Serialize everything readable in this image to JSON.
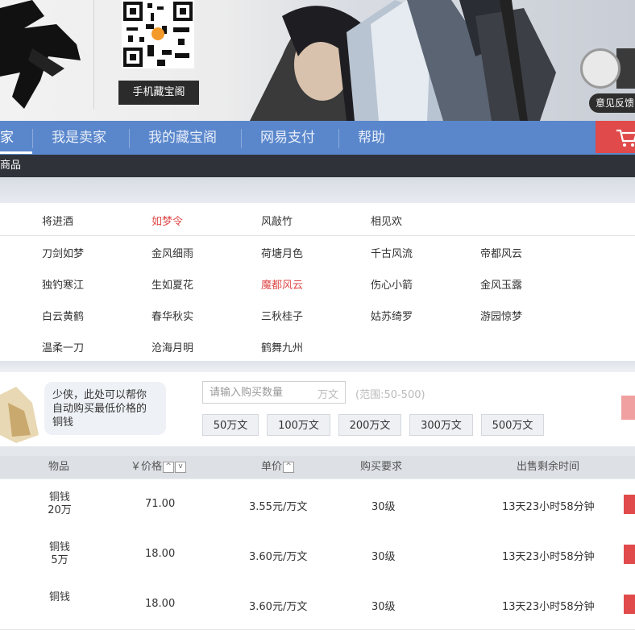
{
  "header": {
    "qr_caption": "手机藏宝阁",
    "feedback_label": "意见反馈"
  },
  "nav": {
    "items": [
      {
        "label": "家"
      },
      {
        "label": "我是卖家"
      },
      {
        "label": "我的藏宝阁"
      },
      {
        "label": "网易支付"
      },
      {
        "label": "帮助"
      }
    ],
    "sub_label": "商品"
  },
  "servers": {
    "top": [
      "将进酒",
      "如梦令",
      "风敲竹",
      "相见欢"
    ],
    "rows": [
      [
        "刀剑如梦",
        "金风细雨",
        "荷塘月色",
        "千古风流",
        "帝都风云"
      ],
      [
        "独钓寒江",
        "生如夏花",
        "魔都风云",
        "伤心小箭",
        "金风玉露"
      ],
      [
        "白云黄鹤",
        "春华秋实",
        "三秋桂子",
        "姑苏绮罗",
        "游园惊梦"
      ],
      [
        "温柔一刀",
        "沧海月明",
        "鹤舞九州"
      ]
    ]
  },
  "helper": {
    "bubble_lines": [
      "少侠，此处可以帮你",
      "自动购买最低价格的",
      "铜钱"
    ],
    "qty_placeholder": "请输入购买数量",
    "qty_unit": "万文",
    "range": "(范围:50-500)",
    "amounts": [
      "50万文",
      "100万文",
      "200万文",
      "300万文",
      "500万文"
    ]
  },
  "table": {
    "headers": {
      "item": "物品",
      "price": "￥价格",
      "unit_price": "单价",
      "requirement": "购买要求",
      "remaining": "出售剩余时间"
    },
    "rows": [
      {
        "item_name": "铜钱",
        "item_qty": "20万",
        "price": "71.00",
        "unit_price": "3.55元/万文",
        "requirement": "30级",
        "remaining": "13天23小时58分钟"
      },
      {
        "item_name": "铜钱",
        "item_qty": "5万",
        "price": "18.00",
        "unit_price": "3.60元/万文",
        "requirement": "30级",
        "remaining": "13天23小时58分钟"
      },
      {
        "item_name": "铜钱",
        "item_qty": "",
        "price": "18.00",
        "unit_price": "3.60元/万文",
        "requirement": "30级",
        "remaining": "13天23小时58分钟"
      }
    ]
  },
  "colors": {
    "nav_blue": "#5a87cc",
    "accent_red": "#e04a4a",
    "dark_bar": "#2f3339"
  }
}
